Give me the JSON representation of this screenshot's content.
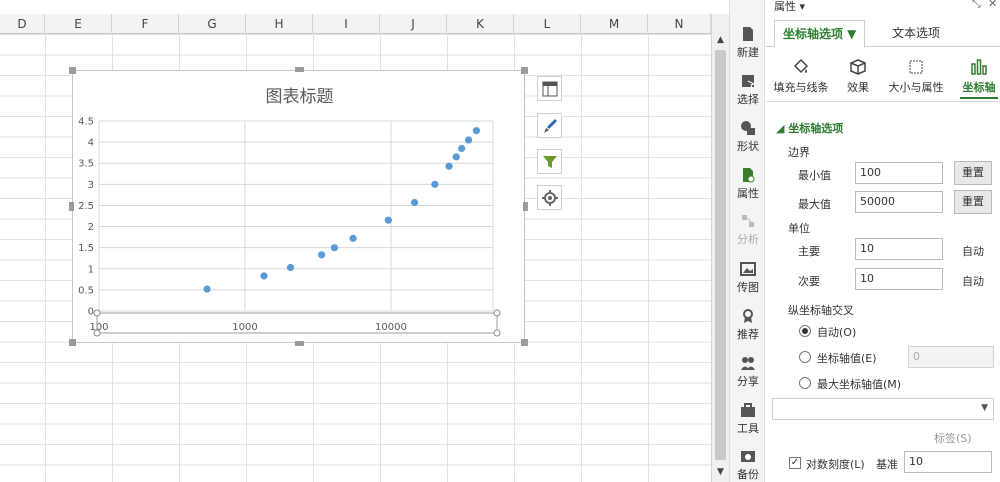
{
  "sheet": {
    "columns": [
      "D",
      "E",
      "F",
      "G",
      "H",
      "I",
      "J",
      "K",
      "L",
      "M",
      "N"
    ]
  },
  "chart_data": {
    "type": "scatter",
    "title": "图表标题",
    "x_scale": "log",
    "x_ticks": [
      "100",
      "1000",
      "10000"
    ],
    "y_ticks": [
      "0",
      "0.5",
      "1",
      "1.5",
      "2",
      "2.5",
      "3",
      "3.5",
      "4",
      "4.5"
    ],
    "xlim": [
      100,
      50000
    ],
    "ylim": [
      0,
      4.5
    ],
    "grid": true,
    "color": "#5b9bd5",
    "x": [
      550,
      1350,
      2050,
      3350,
      4100,
      5500,
      9600,
      14500,
      20000,
      25000,
      28000,
      30500,
      34000,
      38500
    ],
    "y": [
      0.52,
      0.83,
      1.03,
      1.33,
      1.5,
      1.72,
      2.15,
      2.57,
      3.0,
      3.43,
      3.65,
      3.85,
      4.05,
      4.27
    ]
  },
  "toolbar": {
    "items": [
      {
        "label": "新建",
        "icon": "new-file-icon"
      },
      {
        "label": "选择",
        "icon": "select-icon"
      },
      {
        "label": "形状",
        "icon": "shape-icon"
      },
      {
        "label": "属性",
        "icon": "property-icon"
      },
      {
        "label": "分析",
        "icon": "analyze-icon"
      },
      {
        "label": "传图",
        "icon": "image-icon"
      },
      {
        "label": "推荐",
        "icon": "recommend-icon"
      },
      {
        "label": "分享",
        "icon": "share-icon"
      },
      {
        "label": "工具",
        "icon": "toolbox-icon"
      },
      {
        "label": "备份",
        "icon": "backup-icon"
      }
    ]
  },
  "panel": {
    "title": "属性 ▾",
    "tabs": [
      "坐标轴选项 ▼",
      "文本选项"
    ],
    "subtabs": [
      "填充与线条",
      "效果",
      "大小与属性",
      "坐标轴"
    ],
    "section": "◢ 坐标轴选项",
    "bounds_label": "边界",
    "min_label": "最小值",
    "min_value": "100",
    "max_label": "最大值",
    "max_value": "50000",
    "reset": "重置",
    "units_label": "单位",
    "major_label": "主要",
    "major_value": "10",
    "minor_label": "次要",
    "minor_value": "10",
    "auto": "自动",
    "cross_label": "纵坐标轴交叉",
    "cross_auto": "自动(O)",
    "cross_value": "坐标轴值(E)",
    "cross_value_input": "0",
    "cross_max": "最大坐标轴值(M)",
    "label_s": "标签(S)",
    "log_label": "对数刻度(L)",
    "base_label": "基准",
    "base_value": "10"
  }
}
